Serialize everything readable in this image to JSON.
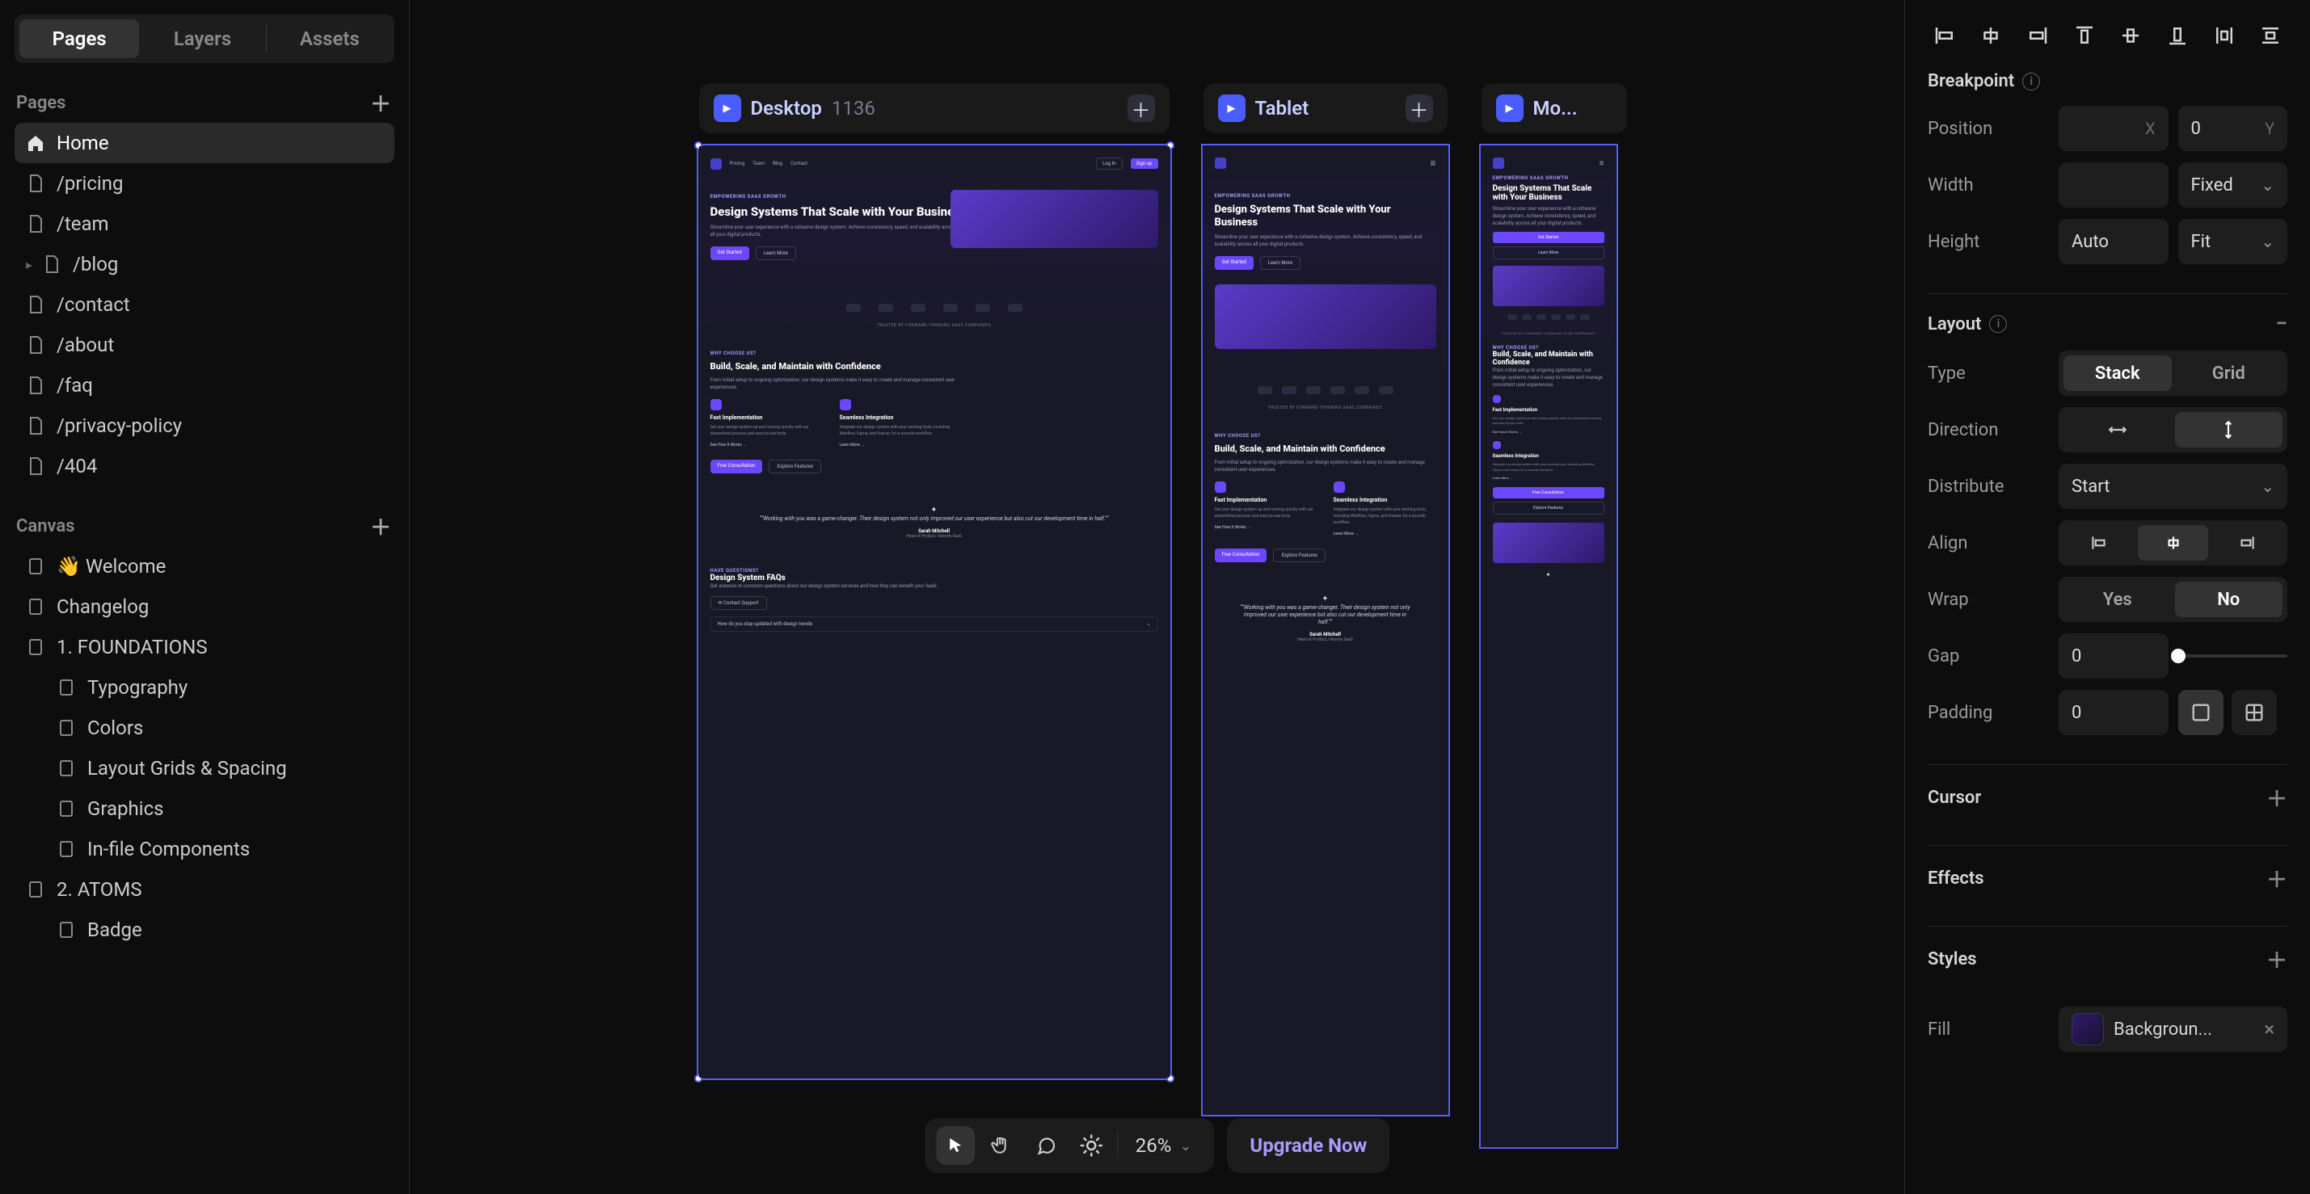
{
  "tabs": {
    "pages": "Pages",
    "layers": "Layers",
    "assets": "Assets"
  },
  "sections": {
    "pages_header": "Pages",
    "canvas_header": "Canvas"
  },
  "pages": [
    {
      "label": "Home",
      "icon": "home",
      "active": true
    },
    {
      "label": "/pricing",
      "icon": "page"
    },
    {
      "label": "/team",
      "icon": "page"
    },
    {
      "label": "/blog",
      "icon": "page",
      "has_children": true
    },
    {
      "label": "/contact",
      "icon": "page"
    },
    {
      "label": "/about",
      "icon": "page"
    },
    {
      "label": "/faq",
      "icon": "page"
    },
    {
      "label": "/privacy-policy",
      "icon": "page"
    },
    {
      "label": "/404",
      "icon": "page"
    }
  ],
  "canvas_items": [
    {
      "label": "👋 Welcome"
    },
    {
      "label": "Changelog"
    },
    {
      "label": "1. FOUNDATIONS"
    },
    {
      "label": "Typography",
      "indent": 1
    },
    {
      "label": "Colors",
      "indent": 1
    },
    {
      "label": "Layout Grids & Spacing",
      "indent": 1
    },
    {
      "label": "Graphics",
      "indent": 1
    },
    {
      "label": "In-file Components",
      "indent": 1
    },
    {
      "label": "2. ATOMS"
    },
    {
      "label": "Badge",
      "indent": 1
    }
  ],
  "toolbar": {
    "zoom": "26%",
    "upgrade_label": "Upgrade Now"
  },
  "frames": {
    "desktop": {
      "name": "Desktop",
      "dim": "1136"
    },
    "tablet": {
      "name": "Tablet"
    },
    "mobile": {
      "name": "Mo..."
    }
  },
  "mock": {
    "eyebrow": "EMPOWERING SAAS GROWTH",
    "h1": "Design Systems That Scale with Your Business",
    "sub": "Streamline your user experience with a cohesive design system. Achieve consistency, speed, and scalability across all your digital products.",
    "cta1": "Get Started",
    "cta2": "Learn More",
    "trusted": "TRUSTED BY FORWARD-THINKING SAAS COMPANIES",
    "why_eyebrow": "WHY CHOOSE US?",
    "h2": "Build, Scale, and Maintain with Confidence",
    "h2_sub": "From initial setup to ongoing optimization, our design systems make it easy to create and manage consistent user experiences.",
    "feat1_title": "Fast Implementation",
    "feat1_body": "Get your design system up and running quickly with our streamlined process and easy-to-use tools.",
    "feat1_link": "See How It Works →",
    "feat2_title": "Seamless Integration",
    "feat2_body": "Integrate our design system with your existing tools, including Webflow, Figma, and Framer, for a smooth workflow.",
    "feat2_link": "Learn More →",
    "consult_btn": "Free Consultation",
    "explore_btn": "Explore Features",
    "quote": "Working with you was a game-changer. Their design system not only improved our user experience but also cut our development time in half.",
    "quote_name": "Sarah Mitchell",
    "quote_role": "Head of Product, Velocity SaaS",
    "faq_eyebrow": "HAVE QUESTIONS?",
    "faq_h": "Design System FAQs",
    "faq_sub": "Get answers to common questions about our design system services and how they can benefit your SaaS.",
    "faq_contact": "Contact Support",
    "faq_q1": "How do you stay updated with design trends"
  },
  "panel": {
    "breakpoint": {
      "title": "Breakpoint",
      "position_label": "Position",
      "y_value": "0",
      "width_label": "Width",
      "width_mode": "Fixed",
      "height_label": "Height",
      "height_value": "Auto",
      "height_mode": "Fit"
    },
    "layout": {
      "title": "Layout",
      "type_label": "Type",
      "type_stack": "Stack",
      "type_grid": "Grid",
      "direction_label": "Direction",
      "distribute_label": "Distribute",
      "distribute_value": "Start",
      "align_label": "Align",
      "wrap_label": "Wrap",
      "wrap_yes": "Yes",
      "wrap_no": "No",
      "gap_label": "Gap",
      "gap_value": "0",
      "padding_label": "Padding",
      "padding_value": "0"
    },
    "cursor": {
      "title": "Cursor"
    },
    "effects": {
      "title": "Effects"
    },
    "styles": {
      "title": "Styles"
    },
    "fill": {
      "title": "Fill",
      "name": "Backgroun..."
    }
  }
}
